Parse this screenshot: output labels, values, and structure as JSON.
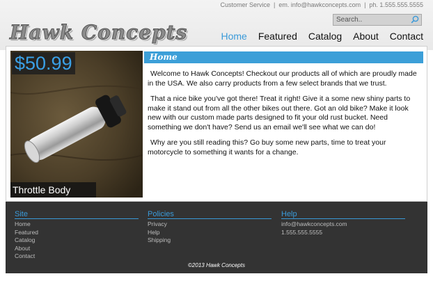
{
  "header": {
    "contact": {
      "service": "Customer Service",
      "email": "em. info@hawkconcepts.com",
      "phone": "ph. 1.555.555.5555"
    },
    "search_placeholder": "Search..",
    "logo": "Hawk Concepts",
    "nav": [
      "Home",
      "Featured",
      "Catalog",
      "About",
      "Contact"
    ],
    "active_nav": "Home"
  },
  "product": {
    "price": "$50.99",
    "name": "Throttle Body"
  },
  "home": {
    "title": "Home",
    "paragraphs": [
      "Welcome to Hawk Concepts! Checkout our products all of which are proudly made in the USA. We also carry products from a few select brands that we trust.",
      "That a nice bike you've got there! Treat it right! Give it a some new shiny parts to make it stand out from all the other bikes out there. Got an old bike? Make it look new with our custom made parts designed to fit your old rust bucket. Need something we don't have? Send us an email we'll see what we can do!",
      "Why are you still reading this? Go buy some new parts, time to treat your motorcycle to something it wants for a change."
    ]
  },
  "footer": {
    "site": {
      "title": "Site",
      "links": [
        "Home",
        "Featured",
        "Catalog",
        "About",
        "Contact"
      ]
    },
    "policies": {
      "title": "Policies",
      "links": [
        "Privacy",
        "Help",
        "Shipping"
      ]
    },
    "help": {
      "title": "Help",
      "items": [
        "info@hawkconcepts.com",
        "1.555.555.5555"
      ]
    },
    "copyright": "©2013 Hawk Concepts"
  },
  "colors": {
    "accent": "#3a9ad9",
    "footer": "#333333"
  },
  "icons": {
    "search": "magnifier-icon"
  }
}
